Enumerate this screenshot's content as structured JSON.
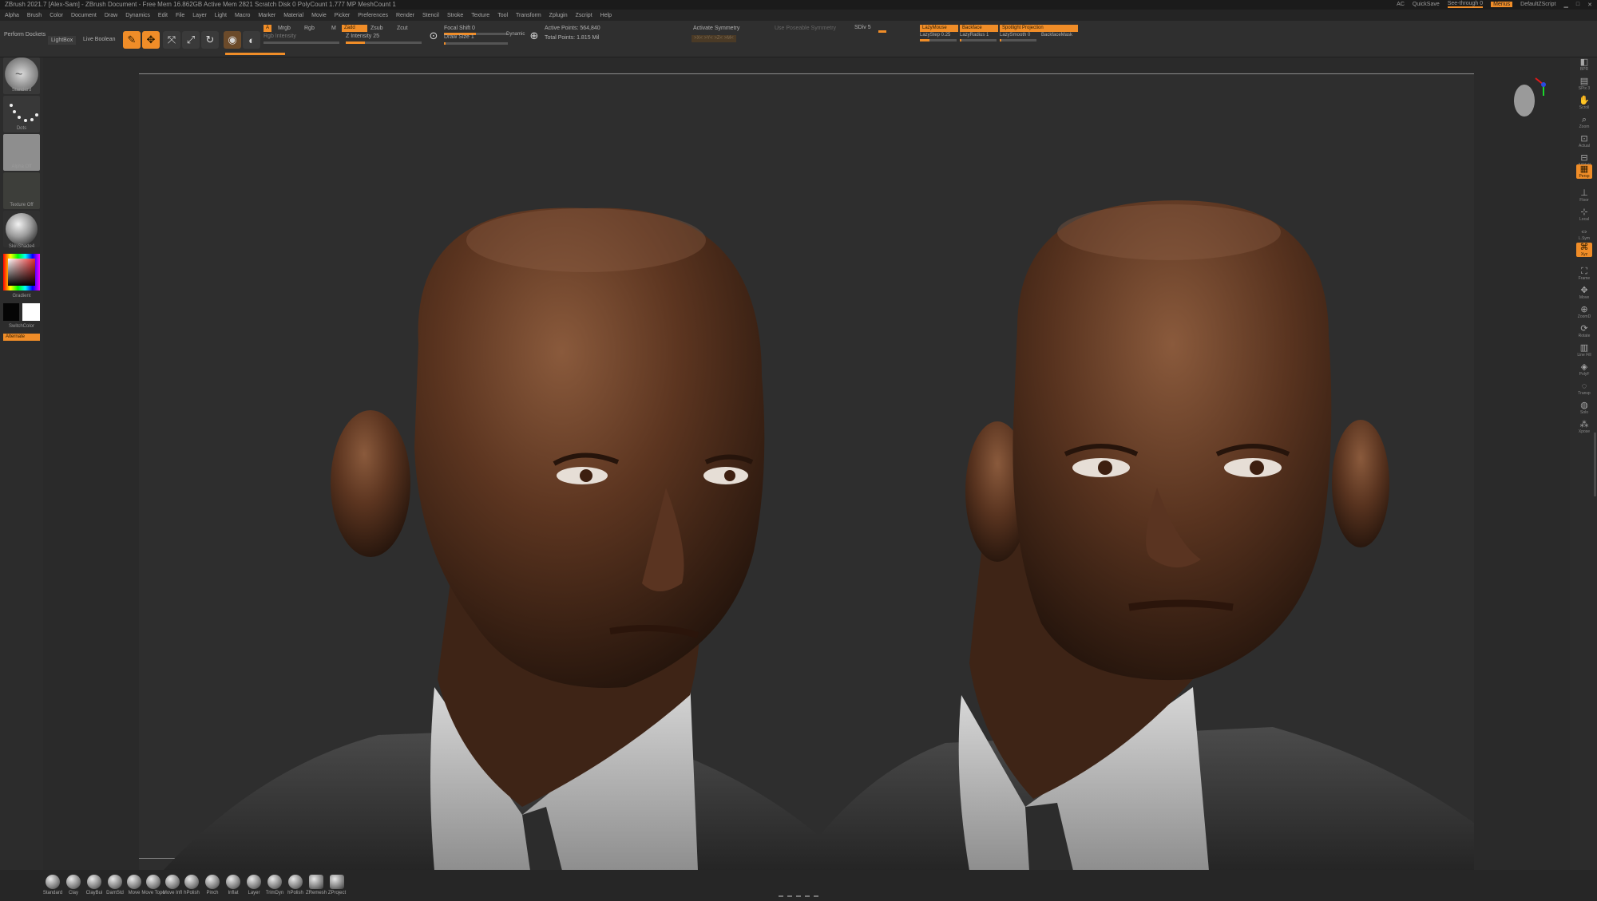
{
  "titlebar": {
    "title": "ZBrush 2021.7 [Alex-Sam] - ZBrush Document - Free Mem 16.862GB Active Mem 2821 Scratch Disk 0 PolyCount 1.777 MP MeshCount 1",
    "right": [
      "AC",
      "QuickSave",
      "See-through 0",
      "Menus",
      "DefaultZScript"
    ]
  },
  "menu": [
    "Alpha",
    "Brush",
    "Color",
    "Document",
    "Draw",
    "Dynamics",
    "Edit",
    "File",
    "Layer",
    "Light",
    "Macro",
    "Marker",
    "Material",
    "Movie",
    "Picker",
    "Preferences",
    "Render",
    "Stencil",
    "Stroke",
    "Texture",
    "Tool",
    "Transform",
    "Zplugin",
    "Zscript",
    "Help"
  ],
  "topshelf": {
    "projection": "Perform Dockets",
    "lightbox": "LightBox",
    "live_boolean": "Live Boolean",
    "tools": [
      {
        "icon": "edit-icon",
        "label": "Edit",
        "active": true
      },
      {
        "icon": "draw-icon",
        "label": "Draw",
        "active": true
      },
      {
        "icon": "move-icon",
        "label": "Move",
        "active": false
      },
      {
        "icon": "scale-icon",
        "label": "Scale",
        "active": false
      },
      {
        "icon": "rotate-icon",
        "label": "Rotate",
        "active": false
      }
    ],
    "mrgb": "Mrgb",
    "rgb": "Rgb",
    "m": "M",
    "zadd": "Zadd",
    "zsub": "Zsub",
    "zcut": "Zcut",
    "rgb_intensity": "Rgb Intensity",
    "z_intensity": "Z Intensity 25",
    "focal_shift": "Focal Shift 0",
    "draw_size": "Draw Size 1",
    "dynamic": "Dynamic",
    "active_points": "Active Points: 564,840",
    "total_points": "Total Points: 1.815 Mil",
    "activate_symmetry": "Activate Symmetry",
    "poseable_symmetry": ">X<  >Y<  >Z<  >M<",
    "sdiv": "SDiv 5",
    "lazy_mouse": "LazyMouse",
    "backface": "Backface",
    "spotlight": "Spotlight Projection",
    "lazy_step": "LazyStep 0.25",
    "lazy_radius": "LazyRadius 1",
    "lazy_smooth": "LazySmooth 0",
    "backface_mask": "BackfaceMask"
  },
  "leftshelf": {
    "brush": "Standard",
    "stroke": "Dots",
    "alpha": "Alpha Off",
    "texture": "Texture Off",
    "material": "SkinShade4",
    "gradient": "Gradient",
    "switch_color": "SwitchColor",
    "alternate": "Alternate"
  },
  "rightshelf": [
    "BPR",
    "SPix 3",
    "Scroll",
    "Zoom",
    "Actual",
    "AAHalf",
    "Persp",
    "Floor",
    "Local",
    "L.Sym",
    "Xyz",
    "Frame",
    "Move",
    "ZoomD",
    "Rotate",
    "Line Fill",
    "PolyF",
    "Transp",
    "Solo",
    "Xpose"
  ],
  "bottomshelf": [
    "Standard",
    "Clay",
    "ClayBui",
    "DamStd",
    "Move",
    "Move Topo",
    "Move Infl",
    "hPolish",
    "Pinch",
    "Inflat",
    "Layer",
    "TrimDyn",
    "hPolish",
    "ZRemesh",
    "ZProject"
  ],
  "colors": {
    "accent": "#f08d28",
    "background": "#2e2e2e",
    "panel": "#2f2f2f"
  }
}
